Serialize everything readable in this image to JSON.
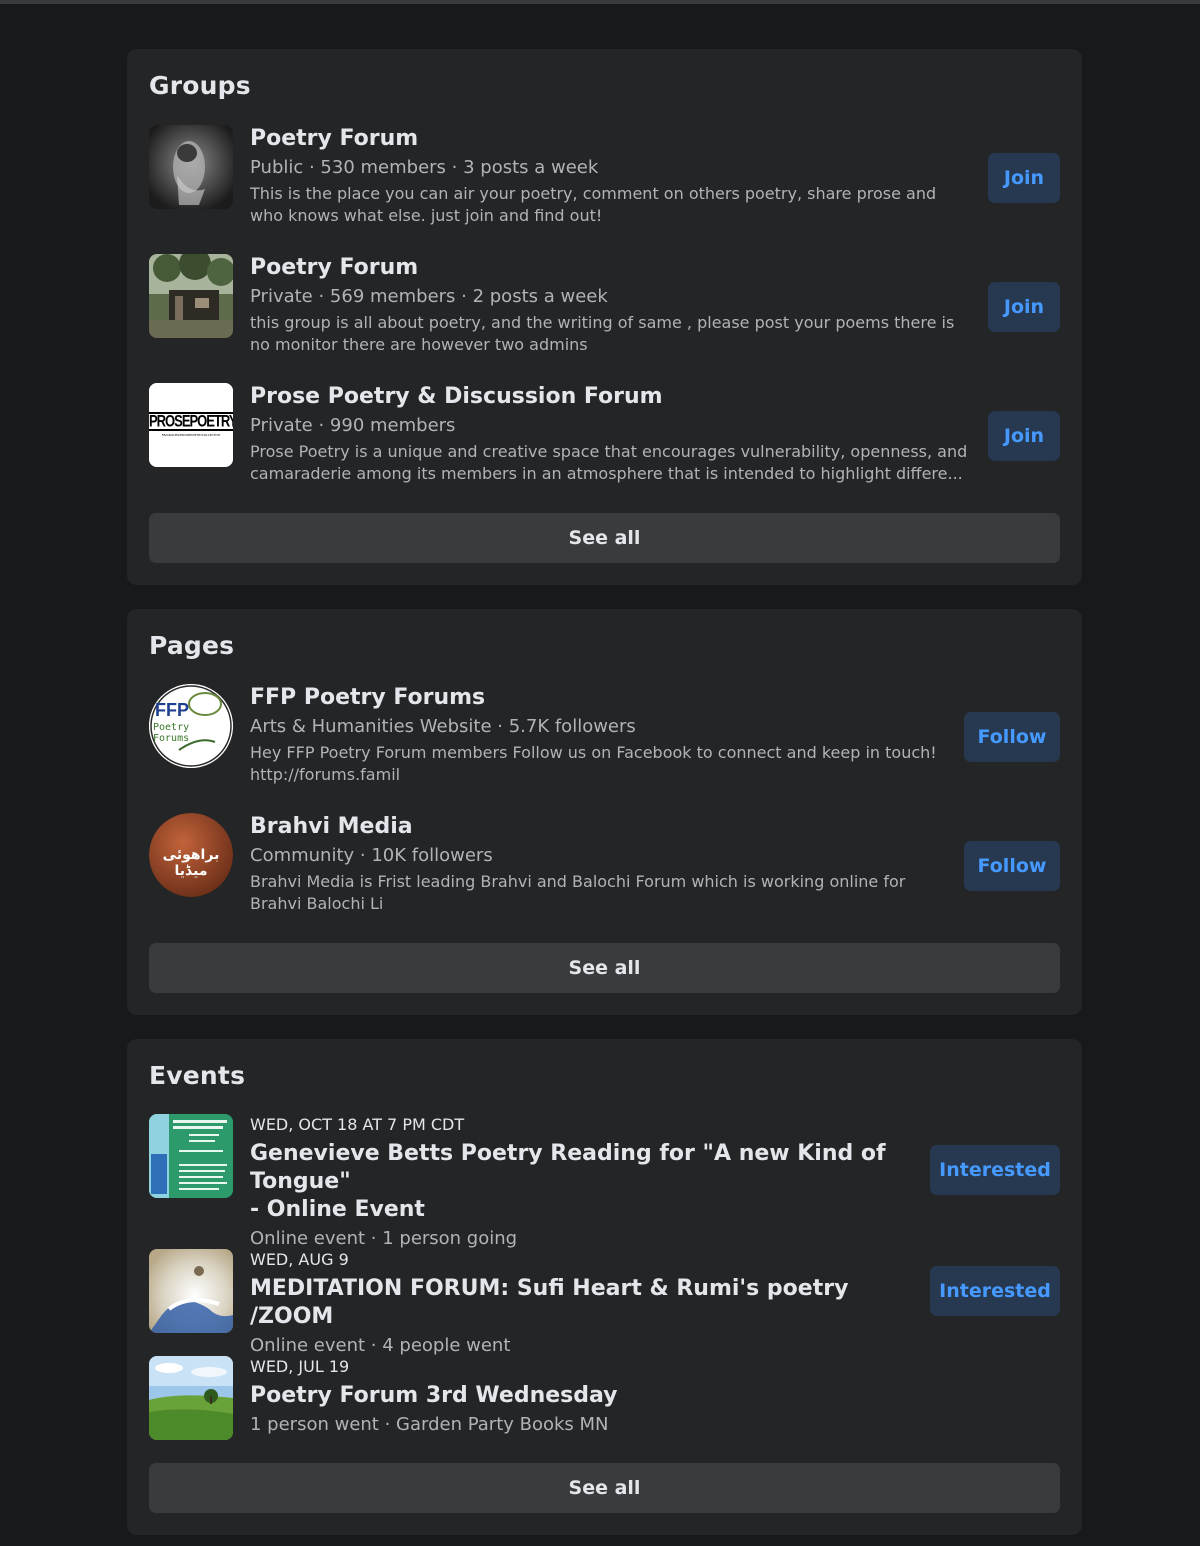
{
  "groups": {
    "title": "Groups",
    "items": [
      {
        "name": "Poetry Forum",
        "meta": "Public · 530 members · 3 posts a week",
        "desc_line1": "This is the place you can air your poetry, comment on others poetry, share prose and",
        "desc_line2": "who knows what else. just join and find out!",
        "button": "Join"
      },
      {
        "name": "Poetry Forum",
        "meta": "Private · 569 members · 2 posts a week",
        "desc_line1": "this group is all about poetry, and the writing of same , please post your poems there is",
        "desc_line2": "no monitor there are however two admins",
        "button": "Join"
      },
      {
        "name": "Prose Poetry & Discussion Forum",
        "meta": "Private · 990 members",
        "desc_line1": "Prose Poetry is a unique and creative space that encourages vulnerability, openness, and",
        "desc_line2": "camaraderie among its members in an atmosphere that is intended to highlight differe...",
        "button": "Join",
        "logo_text": "PROSEPOETRY",
        "logo_subtext": "FB/GROUPS/PROSEPOETRYCOLLECTIVE"
      }
    ],
    "see_all": "See all"
  },
  "pages": {
    "title": "Pages",
    "items": [
      {
        "name": "FFP Poetry Forums",
        "meta": "Arts & Humanities Website · 5.7K followers",
        "desc_line1": "Hey FFP Poetry Forum members Follow us on Facebook to connect and keep in touch!",
        "desc_line2": "http://forums.famil",
        "button": "Follow",
        "logo_text": "FFP",
        "logo_subtext": "Poetry Forums"
      },
      {
        "name": "Brahvi Media",
        "meta": "Community · 10K followers",
        "desc_line1": "Brahvi Media is Frist leading Brahvi and Balochi Forum which is working online for",
        "desc_line2": "Brahvi Balochi Li",
        "button": "Follow",
        "logo_text": "براھوئی میڈیا"
      }
    ],
    "see_all": "See all"
  },
  "events": {
    "title": "Events",
    "items": [
      {
        "date": "WED, OCT 18 AT 7 PM CDT",
        "title_line1": "Genevieve Betts Poetry Reading for \"A new Kind of Tongue\"",
        "title_line2": "- Online Event",
        "meta": "Online event · 1 person going",
        "button": "Interested"
      },
      {
        "date": "WED, AUG 9",
        "title_line1": "MEDITATION FORUM: Sufi Heart & Rumi's poetry /ZOOM",
        "meta": "Online event · 4 people went",
        "button": "Interested"
      },
      {
        "date": "WED, JUL 19",
        "title_line1": "Poetry Forum 3rd Wednesday",
        "meta": "1 person went · Garden Party Books MN"
      }
    ],
    "see_all": "See all"
  },
  "colors": {
    "background": "#18191a",
    "card": "#242526",
    "button_bg": "#263951",
    "button_text": "#4599ff",
    "see_all_bg": "#3a3b3c"
  }
}
